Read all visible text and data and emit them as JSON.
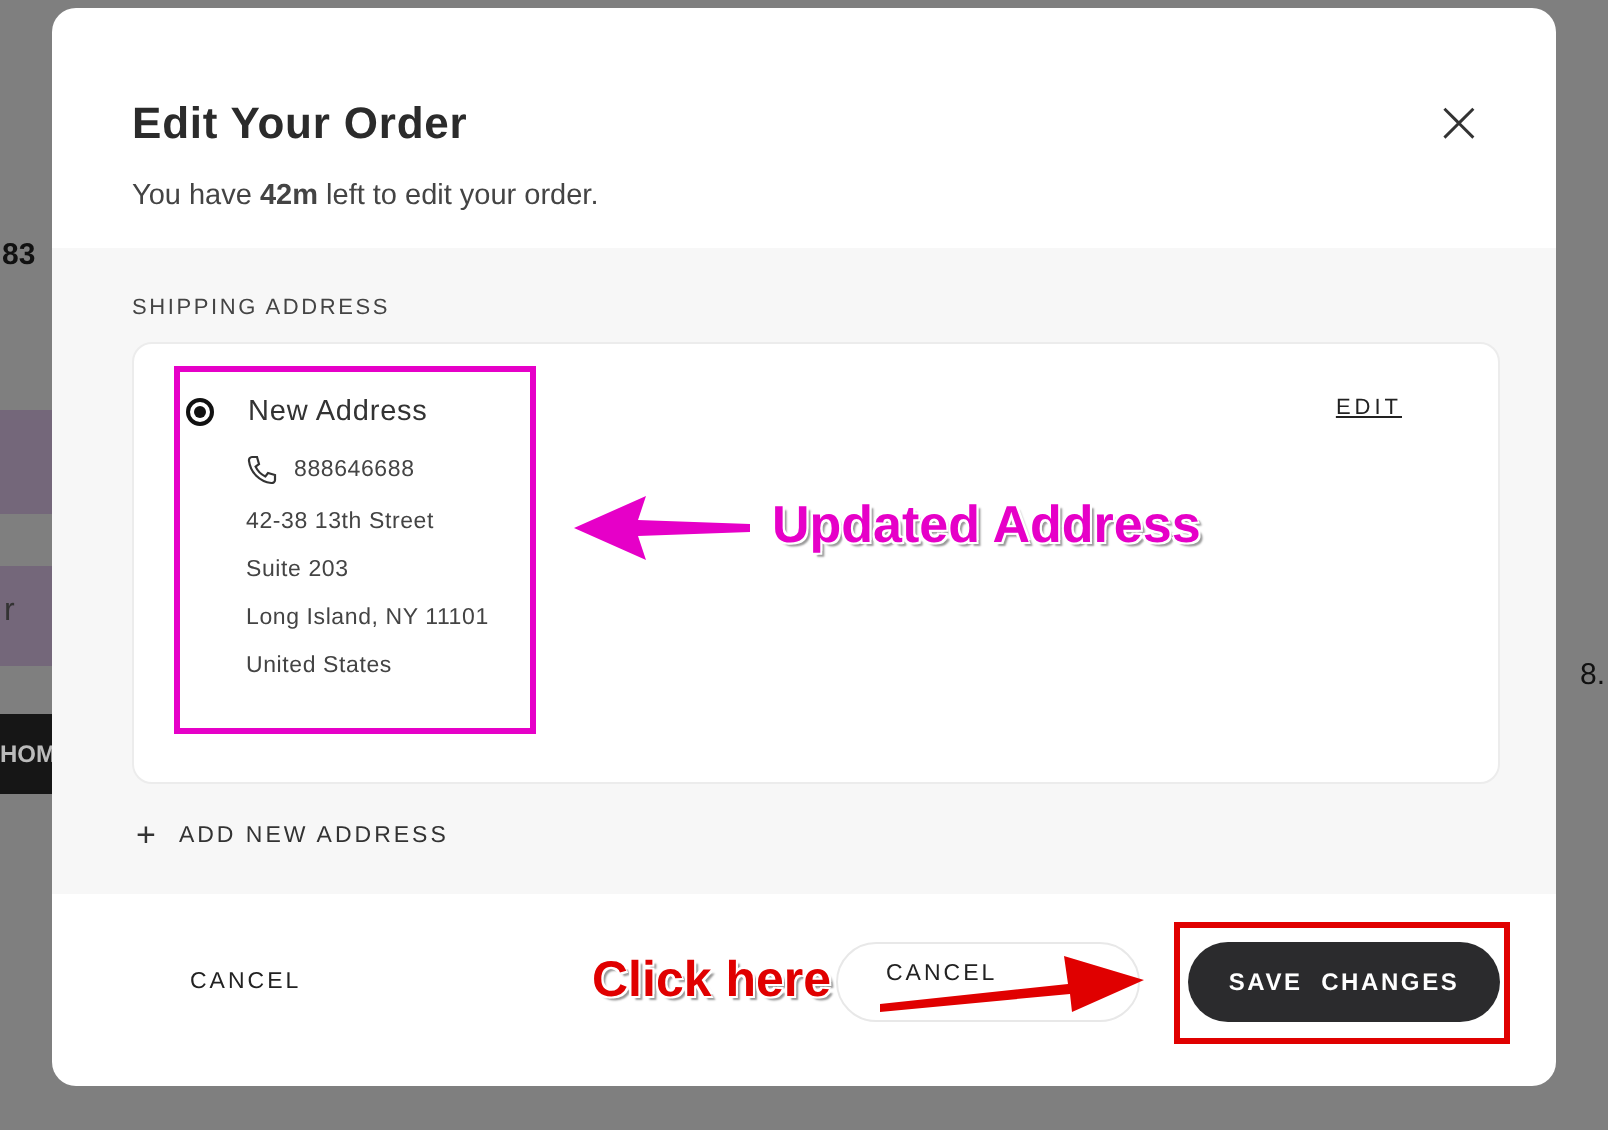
{
  "background": {
    "order_number": "83",
    "banner_text": "r",
    "button_label": "HOM",
    "price": "8."
  },
  "modal": {
    "title": "Edit Your Order",
    "subtitle": "You have **42m** left to edit your order.",
    "close_icon": "×",
    "section_label": "SHIPPING ADDRESS",
    "addresses": [
      {
        "name": "New Address",
        "selected": true,
        "phone": "888646688",
        "lines": [
          "42-38 13th Street",
          "Suite 203",
          "Long Island, NY 11101",
          "United States"
        ],
        "action": "EDIT"
      }
    ],
    "add_address": {
      "icon": "+",
      "label": "ADD NEW ADDRESS"
    },
    "cancel": "CANCEL",
    "cancel_order": "CANCEL",
    "save": "SAVE  CHANGES"
  },
  "annotations": [
    {
      "kind": "address",
      "text": "Updated Address",
      "color": "#e600c8"
    },
    {
      "kind": "save",
      "text": "Click here",
      "color": "#e00000"
    }
  ]
}
